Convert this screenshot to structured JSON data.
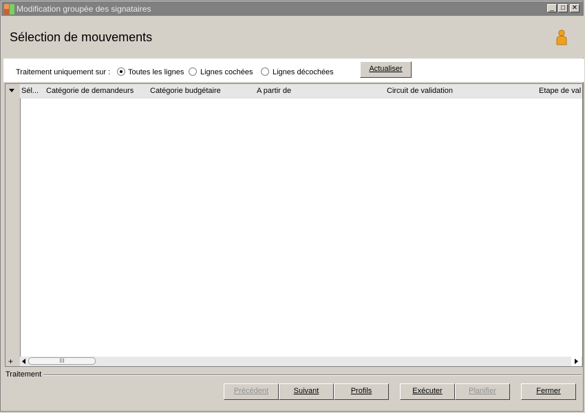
{
  "window": {
    "title": "Modification groupée des signataires",
    "min": "_",
    "max": "□",
    "close": "✕"
  },
  "header": {
    "title": "Sélection de mouvements"
  },
  "filter": {
    "label": "Traitement uniquement sur :",
    "options": [
      {
        "label": "Toutes les lignes",
        "checked": true
      },
      {
        "label": "Lignes cochées",
        "checked": false
      },
      {
        "label": "Lignes décochées",
        "checked": false
      }
    ],
    "refresh_label": "Actualiser"
  },
  "grid": {
    "columns": [
      "Sél...",
      "Catégorie de demandeurs",
      "Catégorie budgétaire",
      "A partir de",
      "Circuit de validation",
      "Etape de val"
    ],
    "rows": [],
    "scroll_thumb": "III",
    "add": "+"
  },
  "footer": {
    "section_label": "Traitement",
    "buttons": {
      "previous": "Précédent",
      "next": "Suivant",
      "profiles": "Profils",
      "execute": "Exécuter",
      "plan": "Planifier",
      "close": "Fermer"
    }
  },
  "colors": {
    "titlebar": "#808080",
    "window_bg": "#d4d0c8",
    "person_icon": "#f0a020"
  }
}
